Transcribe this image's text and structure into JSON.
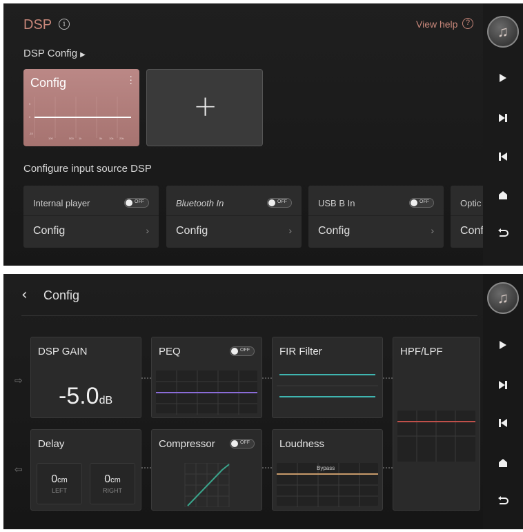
{
  "top": {
    "title": "DSP",
    "view_help": "View help",
    "dsp_config_label": "DSP Config",
    "config_card": {
      "title": "Config",
      "graph_color": "#ffffff"
    },
    "add_symbol": "+",
    "input_source_label": "Configure input source DSP",
    "sources": [
      {
        "name": "Internal player",
        "toggle": "OFF",
        "config": "Config",
        "italic": false
      },
      {
        "name": "Bluetooth In",
        "toggle": "OFF",
        "config": "Config",
        "italic": true
      },
      {
        "name": "USB B In",
        "toggle": "OFF",
        "config": "Config",
        "italic": false
      },
      {
        "name": "Optic",
        "toggle": "",
        "config": "Confi",
        "italic": false
      }
    ]
  },
  "bottom": {
    "title": "Config",
    "modules": {
      "dsp_gain": {
        "label": "DSP GAIN",
        "value": "-5.0",
        "unit": "dB"
      },
      "peq": {
        "label": "PEQ",
        "toggle": "OFF",
        "line_color": "#8a6cd8"
      },
      "fir": {
        "label": "FIR Filter",
        "line_color": "#3fb5b0"
      },
      "hpf": {
        "label": "HPF/LPF",
        "line_color": "#c0504a"
      },
      "delay": {
        "label": "Delay",
        "left_value": "0",
        "left_unit": "cm",
        "left_label": "LEFT",
        "right_value": "0",
        "right_unit": "cm",
        "right_label": "RIGHT"
      },
      "compressor": {
        "label": "Compressor",
        "toggle": "OFF",
        "line_color": "#3aa58c"
      },
      "loudness": {
        "label": "Loudness",
        "bypass_label": "Bypass",
        "line_color": "#c79a6a"
      }
    }
  },
  "colors": {
    "accent": "#c8877a",
    "panel_bg": "#1c1c1c",
    "card_bg": "#2c2c2c"
  }
}
